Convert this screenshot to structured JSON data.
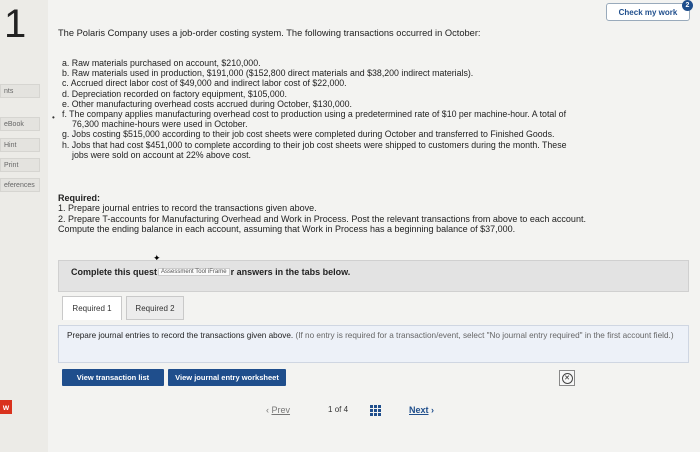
{
  "question": {
    "number": "1"
  },
  "header": {
    "check_label": "Check my work",
    "check_badge": "2"
  },
  "rail": {
    "items": [
      {
        "label": "nts"
      },
      {
        "label": "eBook"
      },
      {
        "label": "Hint"
      },
      {
        "label": "Print"
      },
      {
        "label": "eferences"
      }
    ],
    "w_icon": "w"
  },
  "problem": {
    "intro": "The Polaris Company uses a job-order costing system. The following transactions occurred in October:",
    "transactions": [
      "a. Raw materials purchased on account, $210,000.",
      "b. Raw materials used in production, $191,000 ($152,800 direct materials and $38,200 indirect materials).",
      "c. Accrued direct labor cost of $49,000 and indirect labor cost of $22,000.",
      "d. Depreciation recorded on factory equipment, $105,000.",
      "e. Other manufacturing overhead costs accrued during October, $130,000.",
      "f. The company applies manufacturing overhead cost to production using a predetermined rate of $10 per machine-hour. A total of",
      "76,300 machine-hours were used in October.",
      "g. Jobs costing $515,000 according to their job cost sheets were completed during October and transferred to Finished Goods.",
      "h. Jobs that had cost $451,000 to complete according to their job cost sheets were shipped to customers during the month. These",
      "jobs were sold on account at 22% above cost."
    ],
    "required_head": "Required:",
    "required_lines": [
      "1. Prepare journal entries to record the transactions given above.",
      "2. Prepare T-accounts for Manufacturing Overhead and Work in Process. Post the relevant transactions from above to each account.",
      "Compute the ending balance in each account, assuming that Work in Process has a beginning balance of $37,000."
    ]
  },
  "panel": {
    "text_before": "Complete this quest",
    "iframe_label": "Assessment Tool iFrame",
    "text_after": "r answers in the tabs below."
  },
  "tabs": [
    {
      "label": "Required 1"
    },
    {
      "label": "Required 2"
    }
  ],
  "instruction": {
    "text": "Prepare journal entries to record the transactions given above.",
    "note": "(If no entry is required for a transaction/event, select \"No journal entry required\" in the first account field.)"
  },
  "buttons": {
    "view_list": "View transaction list",
    "view_worksheet": "View journal entry worksheet"
  },
  "pager": {
    "prev": "Prev",
    "page": "1",
    "of": "of 4",
    "next": "Next"
  }
}
